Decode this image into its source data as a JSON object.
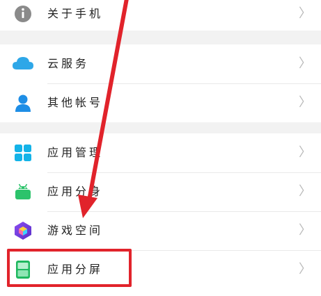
{
  "settings": {
    "groups": [
      {
        "items": [
          {
            "label": "关于手机",
            "icon": "info-icon",
            "chevron": "〉"
          }
        ]
      },
      {
        "items": [
          {
            "label": "云服务",
            "icon": "cloud-icon",
            "chevron": "〉"
          },
          {
            "label": "其他帐号",
            "icon": "person-icon",
            "chevron": "〉"
          }
        ]
      },
      {
        "items": [
          {
            "label": "应用管理",
            "icon": "app-grid-icon",
            "chevron": "〉"
          },
          {
            "label": "应用分身",
            "icon": "android-icon",
            "chevron": "〉"
          },
          {
            "label": "游戏空间",
            "icon": "game-space-icon",
            "chevron": "〉"
          },
          {
            "label": "应用分屏",
            "icon": "split-screen-icon",
            "chevron": "〉"
          }
        ]
      }
    ]
  },
  "annotation": {
    "highlight_color": "#e1232b",
    "highlighted_item": "应用分屏"
  }
}
